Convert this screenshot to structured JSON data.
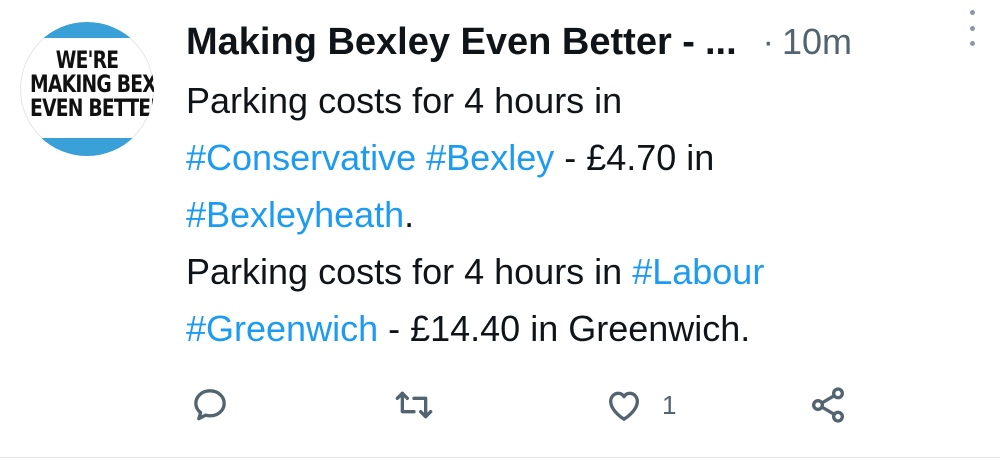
{
  "author": {
    "name": "Making Bexley Even Better -",
    "truncation": "...",
    "separator": "·",
    "time": "10m",
    "avatar_lines": [
      "WE'RE",
      "MAKING BEXLEY",
      "EVEN BETTER"
    ]
  },
  "tweet": {
    "line1": {
      "text": "Parking costs for 4 hours in"
    },
    "line2": {
      "tag1": "#Conservative",
      "space": " ",
      "tag2": "#Bexley",
      "rest": " - £4.70 in"
    },
    "line3": {
      "tag": "#Bexleyheath",
      "rest": "."
    },
    "line4": {
      "text": "Parking costs for 4 hours in ",
      "tag": "#Labour"
    },
    "line5": {
      "tag": "#Greenwich",
      "rest": " - £14.40 in Greenwich."
    }
  },
  "actions": {
    "reply_icon": "reply-icon",
    "retweet_icon": "retweet-icon",
    "like_icon": "heart-icon",
    "like_count": "1",
    "share_icon": "share-icon"
  },
  "colors": {
    "hashtag": "#1d9bf0",
    "text": "#0f1419",
    "muted": "#536471",
    "avatar_band": "#3aa0d8"
  }
}
